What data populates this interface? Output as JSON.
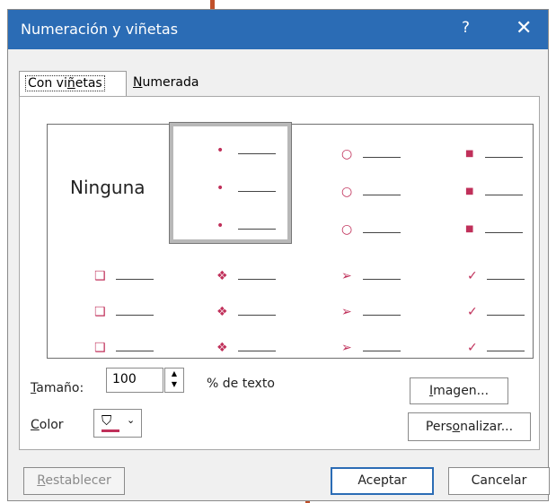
{
  "dialog": {
    "title": "Numeración y viñetas",
    "help": "?",
    "close": "✕"
  },
  "tabs": [
    {
      "label": "Con viñetas"
    },
    {
      "label": "Numerada"
    }
  ],
  "gallery": {
    "none_label": "Ninguna",
    "rows": [
      {
        "symbol": "•",
        "name": "dot"
      },
      {
        "symbol": "○",
        "name": "circle"
      },
      {
        "symbol": "■",
        "name": "square"
      },
      {
        "symbol": "❑",
        "name": "hollow-square"
      },
      {
        "symbol": "❖",
        "name": "diamond"
      },
      {
        "symbol": "➢",
        "name": "arrow"
      },
      {
        "symbol": "✓",
        "name": "check"
      }
    ]
  },
  "size": {
    "label": "Tamaño:",
    "value": "100",
    "suffix": "% de texto"
  },
  "color": {
    "label": "Color",
    "swatch": "#c0305a"
  },
  "buttons": {
    "image": "Imagen...",
    "custom": "Personalizar...",
    "reset": "Restablecer",
    "ok": "Aceptar",
    "cancel": "Cancelar"
  },
  "colors": {
    "accent": "#2b6cb5",
    "bullet": "#c0305a",
    "annotation": "#c0502a"
  }
}
